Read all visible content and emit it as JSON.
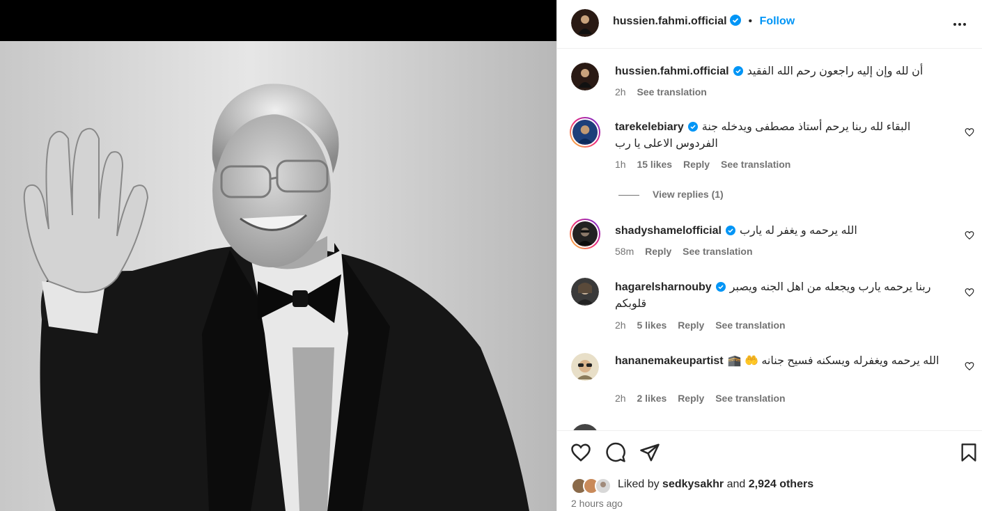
{
  "header": {
    "username": "hussien.fahmi.official",
    "separator": "•",
    "follow_label": "Follow",
    "more_icon": "more-horizontal-icon"
  },
  "caption": {
    "username": "hussien.fahmi.official",
    "text": "أن لله وإن إليه راجعون رحم الله الفقيد",
    "time": "2h",
    "see_translation": "See translation"
  },
  "comments": [
    {
      "username": "tarekelebiary",
      "text": "البقاء لله ربنا يرحم أستاذ مصطفى ويدخله جنة الفردوس الاعلى يا رب",
      "time": "1h",
      "likes": "15 likes",
      "reply": "Reply",
      "see_translation": "See translation",
      "view_replies": "View replies (1)"
    },
    {
      "username": "shadyshamelofficial",
      "text": "الله يرحمه و يغفر له يارب",
      "time": "58m",
      "reply": "Reply",
      "see_translation": "See translation"
    },
    {
      "username": "hagarelsharnouby",
      "text": "ربنا يرحمه يارب ويجعله من اهل الجنه ويصبر قلوبكم",
      "time": "2h",
      "likes": "5 likes",
      "reply": "Reply",
      "see_translation": "See translation"
    },
    {
      "username": "hananemakeupartist",
      "text": "الله يرحمه ويغفرله ويسكنه فسيح جنانه 🤲 🕋",
      "time": "2h",
      "likes": "2 likes",
      "reply": "Reply",
      "see_translation": "See translation"
    }
  ],
  "footer": {
    "liked_by_prefix": "Liked by",
    "liked_by_user": "sedkysakhr",
    "and": "and",
    "others": "2,924 others",
    "time": "2 hours ago"
  },
  "colors": {
    "accent": "#0095f6",
    "verified": "#0095f6",
    "text": "#262626",
    "muted": "#737373",
    "border": "#efefef"
  }
}
